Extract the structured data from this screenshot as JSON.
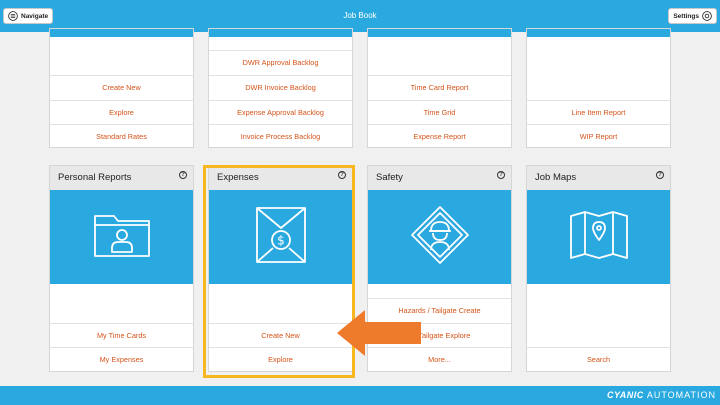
{
  "header": {
    "title": "Job Book",
    "navigate_label": "Navigate",
    "settings_label": "Settings"
  },
  "top_cards": [
    {
      "links": [
        "Create New",
        "Explore",
        "Standard Rates"
      ]
    },
    {
      "links": [
        "DWR Approval Backlog",
        "DWR Invoice Backlog",
        "Expense Approval Backlog",
        "Invoice Process Backlog"
      ]
    },
    {
      "links": [
        "Time Card Report",
        "Time Grid",
        "Expense Report"
      ]
    },
    {
      "links": [
        "Line Item Report",
        "WIP Report"
      ]
    }
  ],
  "bottom_cards": [
    {
      "title": "Personal Reports",
      "icon": "folder-user-icon",
      "links": [
        "My Time Cards",
        "My Expenses"
      ]
    },
    {
      "title": "Expenses",
      "icon": "expense-envelope-icon",
      "links": [
        "Create New",
        "Explore"
      ]
    },
    {
      "title": "Safety",
      "icon": "safety-worker-icon",
      "links": [
        "Hazards / Tailgate Create",
        "s / Tailgate Explore",
        "More..."
      ]
    },
    {
      "title": "Job Maps",
      "icon": "map-pin-icon",
      "links": [
        "Search"
      ]
    }
  ],
  "help_glyph": "?",
  "footer": {
    "brand": "CYANIC",
    "brand_sub": "AUTOMATION"
  },
  "colors": {
    "accent": "#29a9df",
    "link": "#d4541a",
    "highlight": "#f6b723",
    "arrow": "#ee7a2b"
  }
}
